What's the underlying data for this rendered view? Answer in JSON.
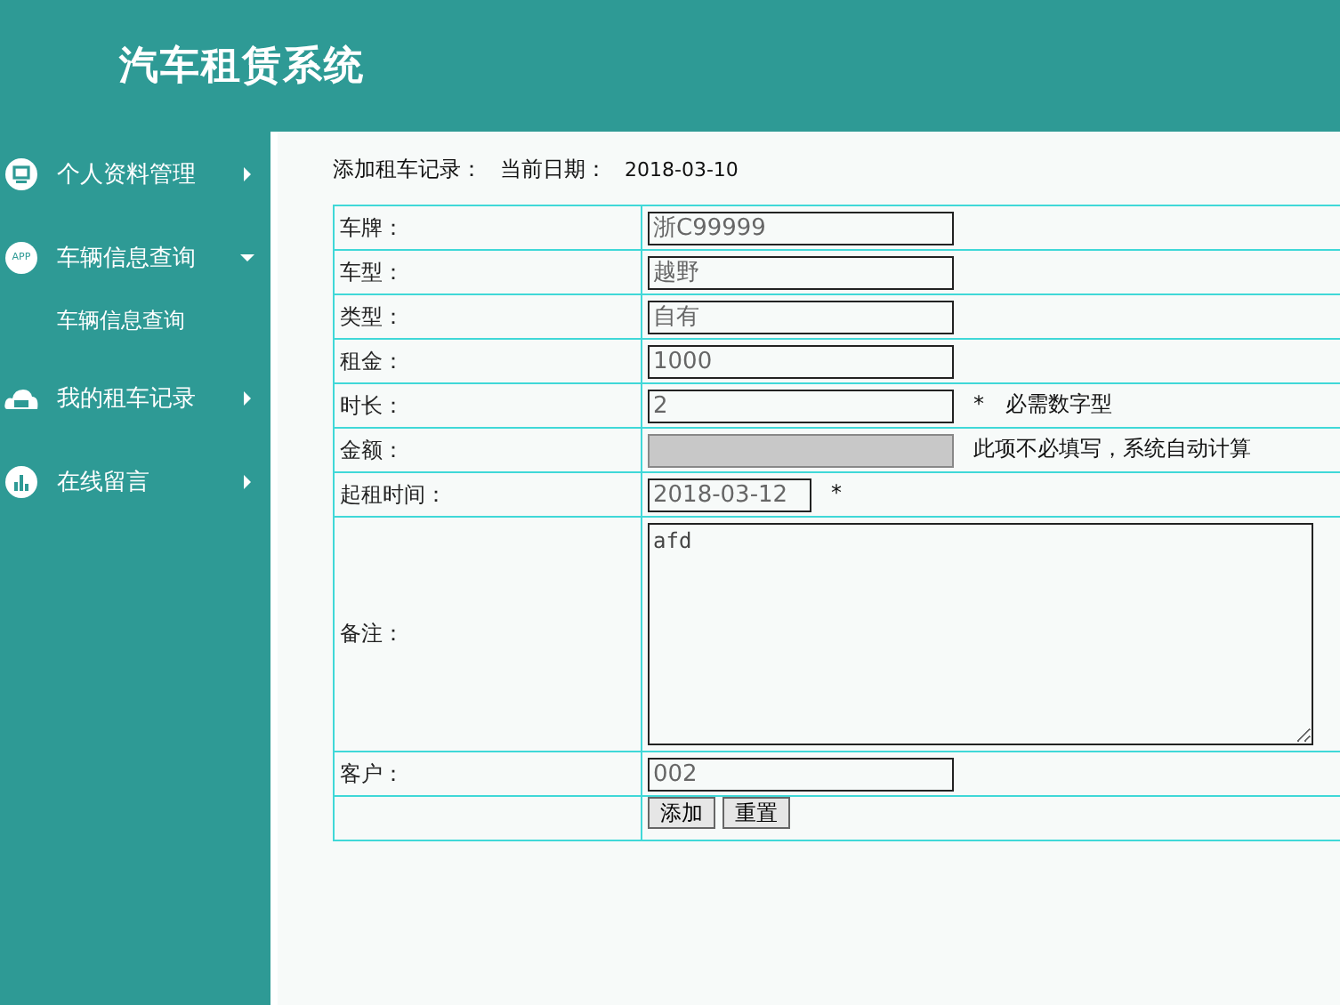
{
  "header": {
    "title": "汽车租赁系统"
  },
  "sidebar": {
    "items": [
      {
        "label": "个人资料管理",
        "expanded": false
      },
      {
        "label": "车辆信息查询",
        "icon_text": "APP",
        "expanded": true,
        "children": [
          {
            "label": "车辆信息查询"
          }
        ]
      },
      {
        "label": "我的租车记录",
        "expanded": false
      },
      {
        "label": "在线留言",
        "expanded": false
      }
    ]
  },
  "form": {
    "title": "添加租车记录：",
    "date_label": "当前日期：",
    "date": "2018-03-10",
    "fields": [
      {
        "kind": "text",
        "label": "车牌：",
        "value": "浙C99999",
        "disabled": false
      },
      {
        "kind": "text",
        "label": "车型：",
        "value": "越野",
        "disabled": false
      },
      {
        "kind": "text",
        "label": "类型：",
        "value": "自有",
        "disabled": false
      },
      {
        "kind": "text",
        "label": "租金：",
        "value": "1000",
        "disabled": false
      },
      {
        "kind": "text",
        "label": "时长：",
        "value": "2",
        "disabled": false,
        "note": "*　必需数字型"
      },
      {
        "kind": "text",
        "label": "金额：",
        "disabled": true,
        "note": "此项不必填写，系统自动计算"
      },
      {
        "kind": "date",
        "label": "起租时间：",
        "value": "2018-03-12",
        "disabled": false,
        "note": "*"
      },
      {
        "kind": "textarea",
        "label": "备注：",
        "value": "afd"
      },
      {
        "kind": "text",
        "label": "客户：",
        "value": "002",
        "disabled": false
      }
    ],
    "buttons": [
      "添加",
      "重置"
    ]
  }
}
